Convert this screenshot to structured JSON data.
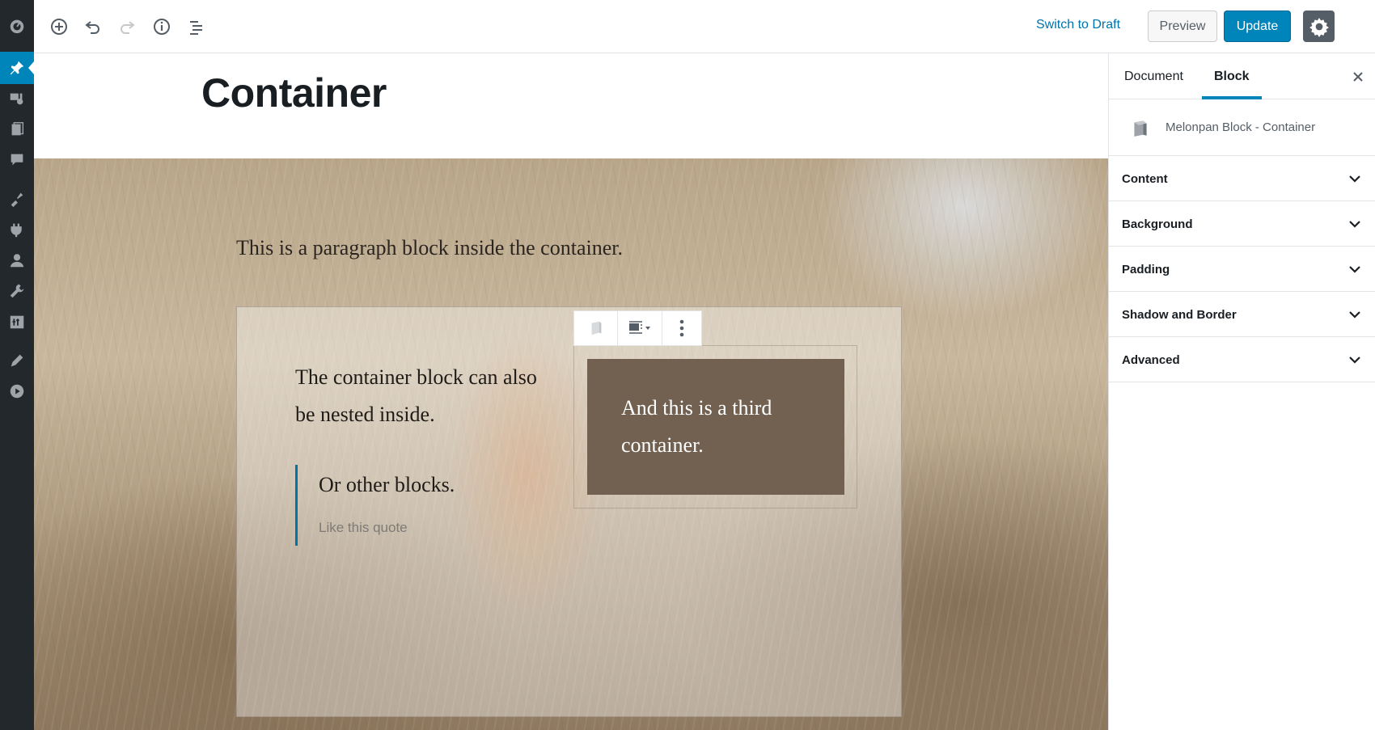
{
  "toolbar": {
    "switch_to_draft": "Switch to Draft",
    "preview": "Preview",
    "update": "Update"
  },
  "editor": {
    "post_title": "Container",
    "cover_paragraph": "This is a paragraph block inside the container.",
    "nested_text": "The container block can also be nested inside.",
    "quote_text": "Or other blocks.",
    "quote_cite": "Like this quote",
    "third_container_text": "And  this is a third container."
  },
  "sidebar": {
    "tabs": [
      "Document",
      "Block"
    ],
    "active_tab": "Block",
    "block_name": "Melonpan Block - Container",
    "panels": [
      "Content",
      "Background",
      "Padding",
      "Shadow and Border",
      "Advanced"
    ]
  },
  "colors": {
    "admin_rail": "#23282d",
    "accent": "#0085ba",
    "link": "#0073aa",
    "third_container_bg": "#726150"
  },
  "icons": {
    "rail": [
      "dashboard-icon",
      "pin-icon",
      "media-icon",
      "pages-icon",
      "comments-icon",
      "appearance-icon",
      "plugins-icon",
      "users-icon",
      "tools-icon",
      "settings-icon",
      "edit-icon",
      "play-icon"
    ],
    "toolbar": [
      "add-block-icon",
      "undo-icon",
      "redo-icon",
      "info-icon",
      "list-icon",
      "gear-icon",
      "more-vertical-icon"
    ]
  }
}
